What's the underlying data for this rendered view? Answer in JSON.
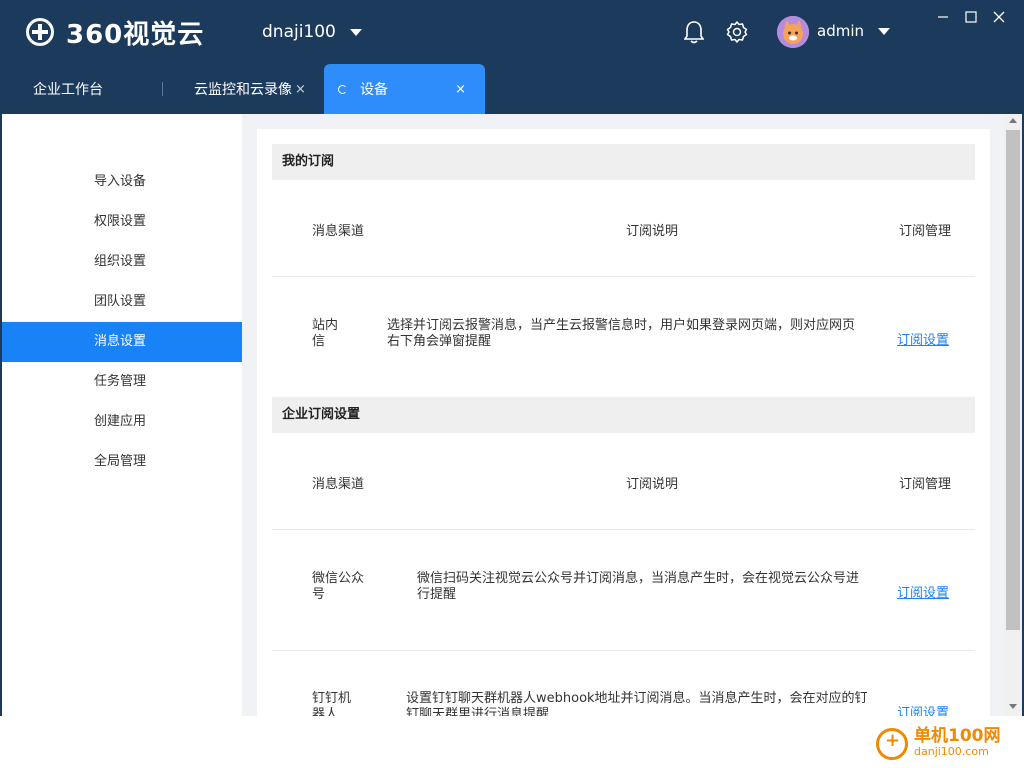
{
  "app": {
    "logo_text": "360视觉云",
    "account": "dnaji100",
    "user": "admin"
  },
  "tabs": {
    "home": "企业工作台",
    "cloud": "云监控和云录像",
    "cloud_close": "×",
    "device": "设备",
    "device_close": "×"
  },
  "sidebar": {
    "items": [
      {
        "label": "导入设备"
      },
      {
        "label": "权限设置"
      },
      {
        "label": "组织设置"
      },
      {
        "label": "团队设置"
      },
      {
        "label": "消息设置"
      },
      {
        "label": "任务管理"
      },
      {
        "label": "创建应用"
      },
      {
        "label": "全局管理"
      }
    ],
    "active_index": 4
  },
  "my_subscription": {
    "title": "我的订阅",
    "columns": [
      "消息渠道",
      "订阅说明",
      "订阅管理"
    ],
    "rows": [
      {
        "channel_line1": "站内",
        "channel_line2": "信",
        "desc_line1": "选择并订阅云报警消息，当产生云报警信息时，用户如果登录网页端，则对应网页",
        "desc_line2": "右下角会弹窗提醒",
        "action": "订阅设置"
      }
    ]
  },
  "enterprise_subscription": {
    "title": "企业订阅设置",
    "columns": [
      "消息渠道",
      "订阅说明",
      "订阅管理"
    ],
    "rows": [
      {
        "channel_line1": "微信公众",
        "channel_line2": "号",
        "desc_line1": "微信扫码关注视觉云公众号并订阅消息，当消息产生时，会在视觉云公众号进",
        "desc_line2": "行提醒",
        "action": "订阅设置"
      },
      {
        "channel_line1": "钉钉机",
        "channel_line2": "器人",
        "desc_line1": "设置钉钉聊天群机器人webhook地址并订阅消息。当消息产生时，会在对应的钉",
        "desc_line2": "钉聊天群里进行消息提醒",
        "action": "订阅设置"
      }
    ]
  },
  "watermark": {
    "title": "单机100网",
    "url": "danji100.com"
  },
  "colors": {
    "header_bg": "#1c3b5c",
    "accent": "#2f8dfb",
    "sidebar_active": "#1a82f7",
    "link": "#1a82f7"
  }
}
